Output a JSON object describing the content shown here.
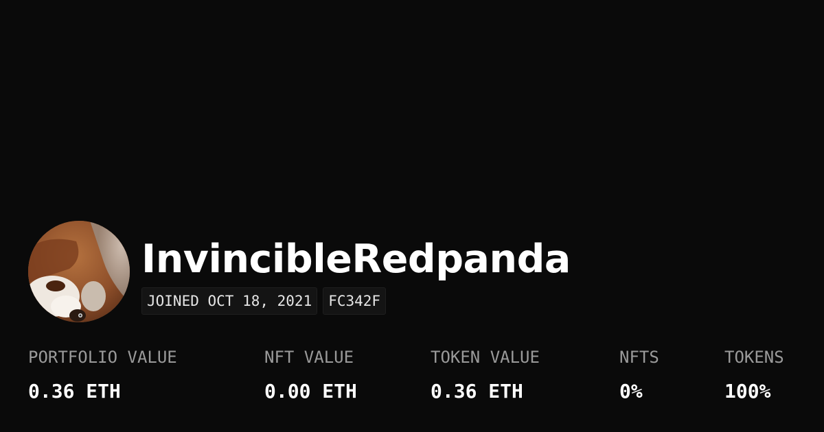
{
  "profile": {
    "username": "InvincibleRedpanda",
    "joined": "JOINED OCT 18, 2021",
    "id_code": "FC342F",
    "avatar_icon": "red-panda-avatar"
  },
  "stats": [
    {
      "label": "PORTFOLIO VALUE",
      "value": "0.36 ETH"
    },
    {
      "label": "NFT VALUE",
      "value": "0.00 ETH"
    },
    {
      "label": "TOKEN VALUE",
      "value": "0.36 ETH"
    },
    {
      "label": "NFTS",
      "value": "0%"
    },
    {
      "label": "TOKENS",
      "value": "100%"
    }
  ],
  "colors": {
    "background": "#0a0a0a",
    "text": "#ffffff",
    "label": "#9a9a9a",
    "badge_bg": "#141414"
  }
}
